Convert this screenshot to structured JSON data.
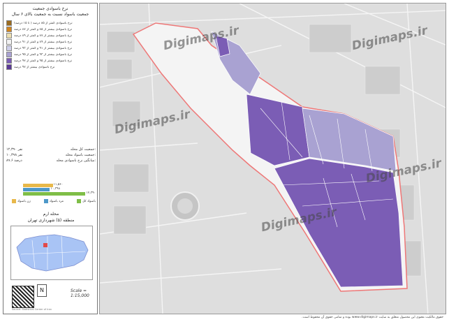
{
  "legend": {
    "title_line1": "نرخ باسوادی جمعیت",
    "title_line2": "جمعیت باسواد نسبت به جمعیت بالای ۶ سال",
    "items": [
      {
        "label": "نرخ باسوادی کمتر از ۸۵ درصد ( تا ۱۵ درصد)",
        "color": "#9a6b1f"
      },
      {
        "label": "نرخ باسوادی بیشتر از ۸۵ و کمتر از ۸۷ درصد",
        "color": "#d2841c"
      },
      {
        "label": "نرخ باسوادی بیشتر از ۸۷ و کمتر از ۸۹ درصد",
        "color": "#ecdfb0"
      },
      {
        "label": "نرخ باسوادی بیشتر از ۸۹ و کمتر از ۹۱ درصد",
        "color": "#f2f2f2"
      },
      {
        "label": "نرخ باسوادی بیشتر از ۹۱ و کمتر از ۹۳ درصد",
        "color": "#cfd0ea"
      },
      {
        "label": "نرخ باسوادی بیشتر از ۹۳ و کمتر از ۹۵ درصد",
        "color": "#a9a2d2"
      },
      {
        "label": "نرخ باسوادی بیشتر از ۹۵ و کمتر از ۹۷ درصد",
        "color": "#7b5db5"
      },
      {
        "label": "نرخ باسوادی بیشتر از ۹۷ درصد",
        "color": "#5b3a95"
      }
    ]
  },
  "stats": {
    "rows": [
      {
        "label": "جمعیت کل محله:",
        "value": "۱۲,۳۹۰ نفر"
      },
      {
        "label": "جمعیت باسواد محله:",
        "value": "۱۰,۳۹۸ نفر"
      },
      {
        "label": "میانگین نرخ باسوادی محله:",
        "value": "۸۹.۶ درصد"
      }
    ]
  },
  "bars": {
    "items": [
      {
        "value": "۱۱,۵۶۰",
        "fraction": 0.41,
        "color": "#e8b84a"
      },
      {
        "value": "۱۰,۳۹۸",
        "fraction": 0.37,
        "color": "#4d98c9"
      },
      {
        "value": "۱۲,۳۹۰",
        "fraction": 0.86,
        "color": "#7fbe47"
      }
    ],
    "legend": [
      {
        "label": "زن باسواد",
        "color": "#e8b84a"
      },
      {
        "label": "مرد باسواد",
        "color": "#4d98c9"
      },
      {
        "label": "باسواد کل",
        "color": "#7fbe47"
      }
    ]
  },
  "location": {
    "title": "محله ارم",
    "subtitle": "منطقه (۵) شهرداری تهران"
  },
  "scale": "Scale = 1:15,000",
  "north": "N",
  "credit": "Source: Statistical Center of Iran",
  "watermark": "Digimaps.ir",
  "footer": "حقوق مالکیت معنوی این محصول متعلق به سایت www.digimaps.ir بوده و تمامی حقوق آن محفوظ است."
}
